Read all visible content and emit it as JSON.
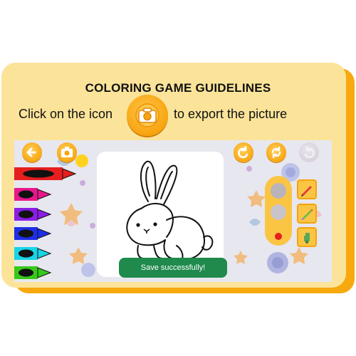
{
  "header": {
    "title": "COLORING GAME GUIDELINES",
    "instruction_before": "Click on the icon",
    "instruction_after": "to export the picture"
  },
  "icons": {
    "export": "camera-icon",
    "back": "arrow-left-icon",
    "undo": "undo-icon",
    "redo": "redo-icon",
    "reset": "refresh-icon",
    "pencil": "pencil-icon",
    "brush": "brush-icon",
    "bucket": "paint-bucket-icon"
  },
  "crayons": [
    {
      "color": "#e61e1e"
    },
    {
      "color": "#e6188c"
    },
    {
      "color": "#8a1ee6"
    },
    {
      "color": "#1e2ee6"
    },
    {
      "color": "#18d4e6"
    },
    {
      "color": "#36c91a"
    }
  ],
  "toast": {
    "message": "Save successfully!"
  },
  "colors": {
    "card": "#fbe49a",
    "card_shadow": "#f7a90e",
    "button": "#f7a40f",
    "toast": "#1f8a4c"
  }
}
